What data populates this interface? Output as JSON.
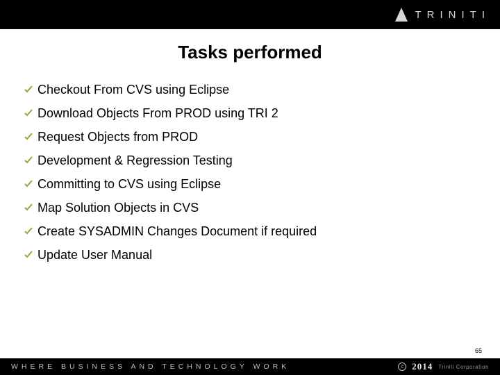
{
  "brand": {
    "name": "TRINITI"
  },
  "title": "Tasks performed",
  "items": [
    "Checkout From CVS using Eclipse",
    "Download Objects From PROD using TRI 2",
    "Request Objects from PROD",
    "Development & Regression Testing",
    "Committing to CVS using Eclipse",
    "Map Solution Objects in CVS",
    "Create SYSADMIN Changes Document if required",
    "Update User Manual"
  ],
  "page_number": "65",
  "footer": {
    "tagline": "WHERE BUSINESS AND TECHNOLOGY WORK",
    "copyright_symbol": "c",
    "year": "2014",
    "corp": "Triniti Corporation"
  },
  "colors": {
    "check": "#9aa53a"
  }
}
